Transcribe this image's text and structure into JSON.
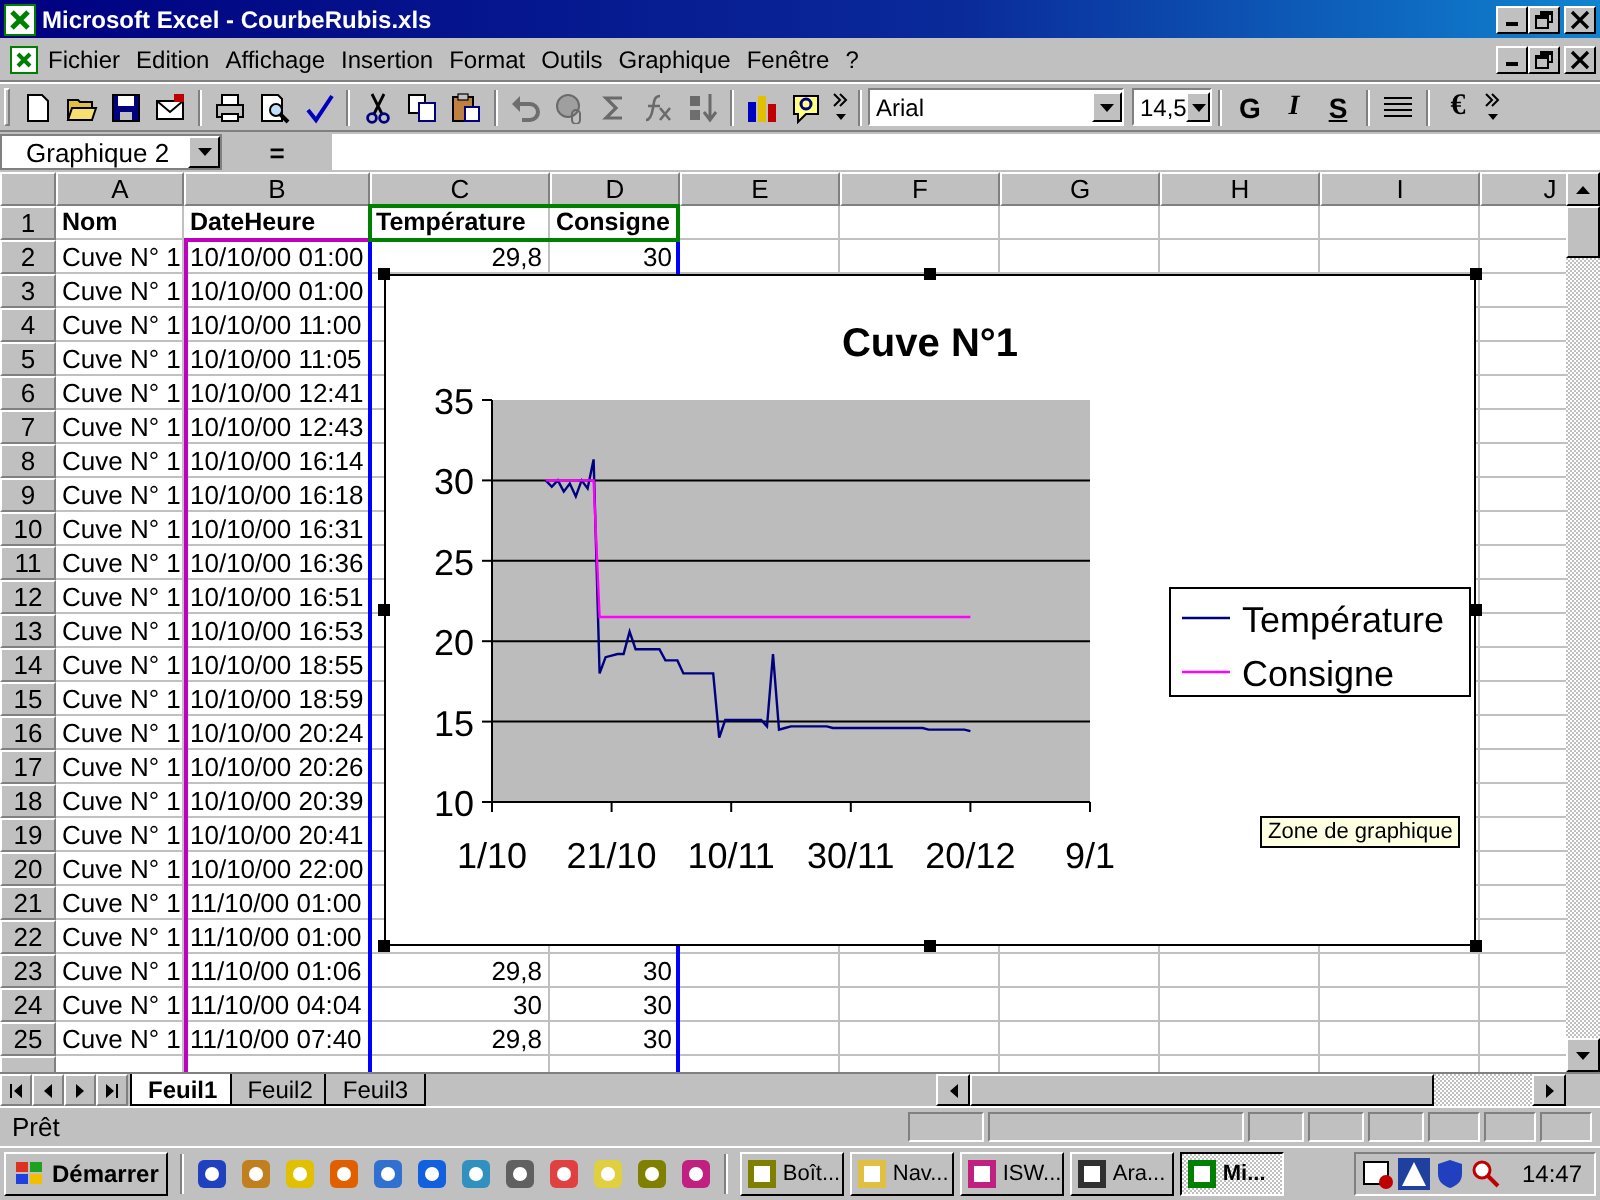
{
  "window": {
    "title": "Microsoft Excel - CourbeRubis.xls"
  },
  "menu": [
    "Fichier",
    "Edition",
    "Affichage",
    "Insertion",
    "Format",
    "Outils",
    "Graphique",
    "Fenêtre",
    "?"
  ],
  "toolbar": {
    "buttons": [
      {
        "kind": "new",
        "disabled": false
      },
      {
        "kind": "open",
        "disabled": false
      },
      {
        "kind": "save",
        "disabled": false
      },
      {
        "kind": "mail",
        "disabled": false
      },
      {
        "kind": "print",
        "disabled": false
      },
      {
        "kind": "preview",
        "disabled": false
      },
      {
        "kind": "spell",
        "disabled": false
      },
      {
        "kind": "cut",
        "disabled": false
      },
      {
        "kind": "copy",
        "disabled": false
      },
      {
        "kind": "paste",
        "disabled": false
      },
      {
        "kind": "undo",
        "disabled": true
      },
      {
        "kind": "link",
        "disabled": true
      },
      {
        "kind": "sum",
        "disabled": true
      },
      {
        "kind": "function",
        "disabled": true
      },
      {
        "kind": "sort",
        "disabled": true
      },
      {
        "kind": "chart",
        "disabled": false
      },
      {
        "kind": "help",
        "disabled": false
      }
    ],
    "font": "Arial",
    "size": "14,5",
    "format_buttons": [
      "G",
      "I",
      "S"
    ],
    "currency": "€"
  },
  "formula_bar": {
    "name_box": "Graphique 2",
    "equals": "="
  },
  "columns": [
    "A",
    "B",
    "C",
    "D",
    "E",
    "F",
    "G",
    "H",
    "I",
    "J"
  ],
  "rows": [
    {
      "header": "1",
      "cells": [
        "Nom",
        "DateHeure",
        "Température",
        "Consigne"
      ]
    },
    {
      "header": "2",
      "cells": [
        "Cuve N° 1",
        "10/10/00 01:00",
        "29,8",
        "30"
      ]
    },
    {
      "header": "3",
      "cells": [
        "Cuve N° 1",
        "10/10/00 01:00"
      ]
    },
    {
      "header": "4",
      "cells": [
        "Cuve N° 1",
        "10/10/00 11:00"
      ]
    },
    {
      "header": "5",
      "cells": [
        "Cuve N° 1",
        "10/10/00 11:05"
      ]
    },
    {
      "header": "6",
      "cells": [
        "Cuve N° 1",
        "10/10/00 12:41"
      ]
    },
    {
      "header": "7",
      "cells": [
        "Cuve N° 1",
        "10/10/00 12:43"
      ]
    },
    {
      "header": "8",
      "cells": [
        "Cuve N° 1",
        "10/10/00 16:14"
      ]
    },
    {
      "header": "9",
      "cells": [
        "Cuve N° 1",
        "10/10/00 16:18"
      ]
    },
    {
      "header": "10",
      "cells": [
        "Cuve N° 1",
        "10/10/00 16:31"
      ]
    },
    {
      "header": "11",
      "cells": [
        "Cuve N° 1",
        "10/10/00 16:36"
      ]
    },
    {
      "header": "12",
      "cells": [
        "Cuve N° 1",
        "10/10/00 16:51"
      ]
    },
    {
      "header": "13",
      "cells": [
        "Cuve N° 1",
        "10/10/00 16:53"
      ]
    },
    {
      "header": "14",
      "cells": [
        "Cuve N° 1",
        "10/10/00 18:55"
      ]
    },
    {
      "header": "15",
      "cells": [
        "Cuve N° 1",
        "10/10/00 18:59"
      ]
    },
    {
      "header": "16",
      "cells": [
        "Cuve N° 1",
        "10/10/00 20:24"
      ]
    },
    {
      "header": "17",
      "cells": [
        "Cuve N° 1",
        "10/10/00 20:26"
      ]
    },
    {
      "header": "18",
      "cells": [
        "Cuve N° 1",
        "10/10/00 20:39"
      ]
    },
    {
      "header": "19",
      "cells": [
        "Cuve N° 1",
        "10/10/00 20:41"
      ]
    },
    {
      "header": "20",
      "cells": [
        "Cuve N° 1",
        "10/10/00 22:00"
      ]
    },
    {
      "header": "21",
      "cells": [
        "Cuve N° 1",
        "11/10/00 01:00"
      ]
    },
    {
      "header": "22",
      "cells": [
        "Cuve N° 1",
        "11/10/00 01:00"
      ]
    },
    {
      "header": "23",
      "cells": [
        "Cuve N° 1",
        "11/10/00 01:06",
        "29,8",
        "30"
      ]
    },
    {
      "header": "24",
      "cells": [
        "Cuve N° 1",
        "11/10/00 04:04",
        "30",
        "30"
      ]
    },
    {
      "header": "25",
      "cells": [
        "Cuve N° 1",
        "11/10/00 07:40",
        "29,8",
        "30"
      ]
    }
  ],
  "chart": {
    "tooltip": "Zone de graphique",
    "chart_data": {
      "type": "line",
      "title": "Cuve N°1",
      "categories": [
        "1/10",
        null,
        null,
        null,
        null,
        null,
        null,
        null,
        null,
        null,
        null,
        null,
        null,
        null,
        null,
        null,
        null,
        null,
        null,
        null,
        "21/10",
        null,
        null,
        null,
        null,
        null,
        null,
        null,
        null,
        null,
        null,
        null,
        null,
        null,
        null,
        null,
        null,
        null,
        null,
        null,
        "10/11",
        null,
        null,
        null,
        null,
        null,
        null,
        null,
        null,
        null,
        null,
        null,
        null,
        null,
        null,
        null,
        null,
        null,
        null,
        null,
        "30/11",
        null,
        null,
        null,
        null,
        null,
        null,
        null,
        null,
        null,
        null,
        null,
        null,
        null,
        null,
        null,
        null,
        null,
        null,
        null,
        "20/12",
        null,
        null,
        null,
        null,
        null,
        null,
        null,
        null,
        null,
        null,
        null,
        null,
        null,
        null,
        null,
        null,
        null,
        null,
        null,
        "9/1"
      ],
      "series": [
        {
          "name": "Température",
          "color": "#000080",
          "values": [
            null,
            null,
            null,
            null,
            null,
            null,
            null,
            null,
            null,
            30,
            29.6,
            30,
            29.3,
            29.8,
            29,
            30,
            29.5,
            31.3,
            18,
            19,
            19.1,
            19.2,
            19.2,
            20.6,
            19.5,
            19.5,
            19.5,
            19.5,
            19.5,
            18.8,
            18.8,
            18.8,
            18,
            18,
            18,
            18,
            18,
            18,
            14,
            15.1,
            15.1,
            15.1,
            15.1,
            15.1,
            15.1,
            15.1,
            14.7,
            19.2,
            14.5,
            14.6,
            14.7,
            14.7,
            14.7,
            14.7,
            14.7,
            14.7,
            14.7,
            14.6,
            14.6,
            14.6,
            14.6,
            14.6,
            14.6,
            14.6,
            14.6,
            14.6,
            14.6,
            14.6,
            14.6,
            14.6,
            14.6,
            14.6,
            14.6,
            14.5,
            14.5,
            14.5,
            14.5,
            14.5,
            14.5,
            14.5,
            14.4,
            null,
            null,
            null,
            null,
            null,
            null,
            null,
            null,
            null,
            null,
            null,
            null,
            null,
            null,
            null,
            null,
            null,
            null,
            null,
            null
          ]
        },
        {
          "name": "Consigne",
          "color": "#ff00ff",
          "values": [
            null,
            null,
            null,
            null,
            null,
            null,
            null,
            null,
            null,
            30,
            30,
            30,
            30,
            30,
            30,
            30,
            30,
            30,
            21.5,
            21.5,
            21.5,
            21.5,
            21.5,
            21.5,
            21.5,
            21.5,
            21.5,
            21.5,
            21.5,
            21.5,
            21.5,
            21.5,
            21.5,
            21.5,
            21.5,
            21.5,
            21.5,
            21.5,
            21.5,
            21.5,
            21.5,
            21.5,
            21.5,
            21.5,
            21.5,
            21.5,
            21.5,
            21.5,
            21.5,
            21.5,
            21.5,
            21.5,
            21.5,
            21.5,
            21.5,
            21.5,
            21.5,
            21.5,
            21.5,
            21.5,
            21.5,
            21.5,
            21.5,
            21.5,
            21.5,
            21.5,
            21.5,
            21.5,
            21.5,
            21.5,
            21.5,
            21.5,
            21.5,
            21.5,
            21.5,
            21.5,
            21.5,
            21.5,
            21.5,
            21.5,
            21.5,
            null,
            null,
            null,
            null,
            null,
            null,
            null,
            null,
            null,
            null,
            null,
            null,
            null,
            null,
            null,
            null,
            null,
            null,
            null,
            null
          ]
        }
      ],
      "ylim": [
        10,
        35
      ],
      "grid": true,
      "legend": "right",
      "yticks": [
        10,
        15,
        20,
        25,
        30,
        35
      ]
    }
  },
  "sheet_tabs": [
    {
      "label": "Feuil1",
      "selected": true
    },
    {
      "label": "Feuil2",
      "selected": false
    },
    {
      "label": "Feuil3",
      "selected": false
    }
  ],
  "status_bar": {
    "text": "Prêt"
  },
  "taskbar": {
    "start": "Démarrer",
    "tasks": [
      {
        "label": "Boît...",
        "selected": false
      },
      {
        "label": "Nav...",
        "selected": false
      },
      {
        "label": "ISW...",
        "selected": false
      },
      {
        "label": "Ara...",
        "selected": false
      },
      {
        "label": "Mi...",
        "selected": true
      }
    ],
    "clock": "14:47"
  }
}
